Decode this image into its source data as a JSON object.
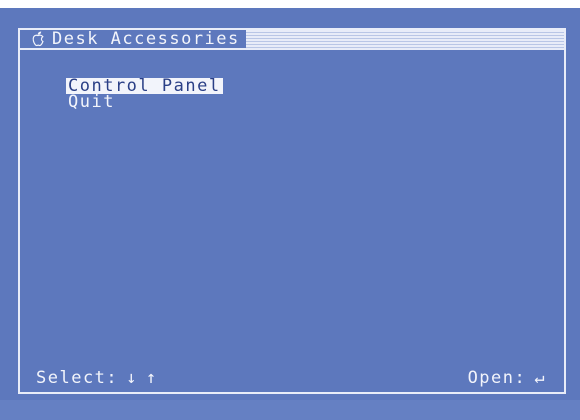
{
  "window": {
    "title": "Desk Accessories",
    "title_icon": "apple-icon"
  },
  "menu": {
    "items": [
      {
        "label": "Control Panel",
        "selected": true
      },
      {
        "label": "Quit",
        "selected": false
      }
    ]
  },
  "footer": {
    "select_label": "Select:",
    "select_keys": [
      "↓",
      "↑"
    ],
    "open_label": "Open:",
    "open_key": "↵"
  },
  "colors": {
    "background": "#5d78bd",
    "foreground": "#f2f4fb",
    "highlight_text": "#2a3f86"
  }
}
